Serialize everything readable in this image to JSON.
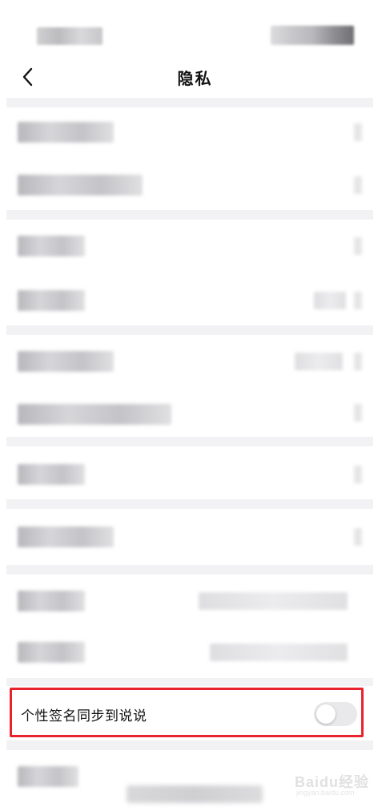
{
  "header": {
    "title": "隐私",
    "back_icon": "chevron-left-icon"
  },
  "sync_signature": {
    "label": "个性签名同步到说说",
    "toggle_on": false,
    "highlight_color": "#e8232b"
  },
  "watermark": {
    "text": "Baidu经验",
    "sub": "jingyan.baidu.com"
  },
  "colors": {
    "background": "#ffffff",
    "section_gap": "#f2f2f4",
    "toggle_off": "#e9e9ec",
    "highlight": "#e8232b"
  }
}
